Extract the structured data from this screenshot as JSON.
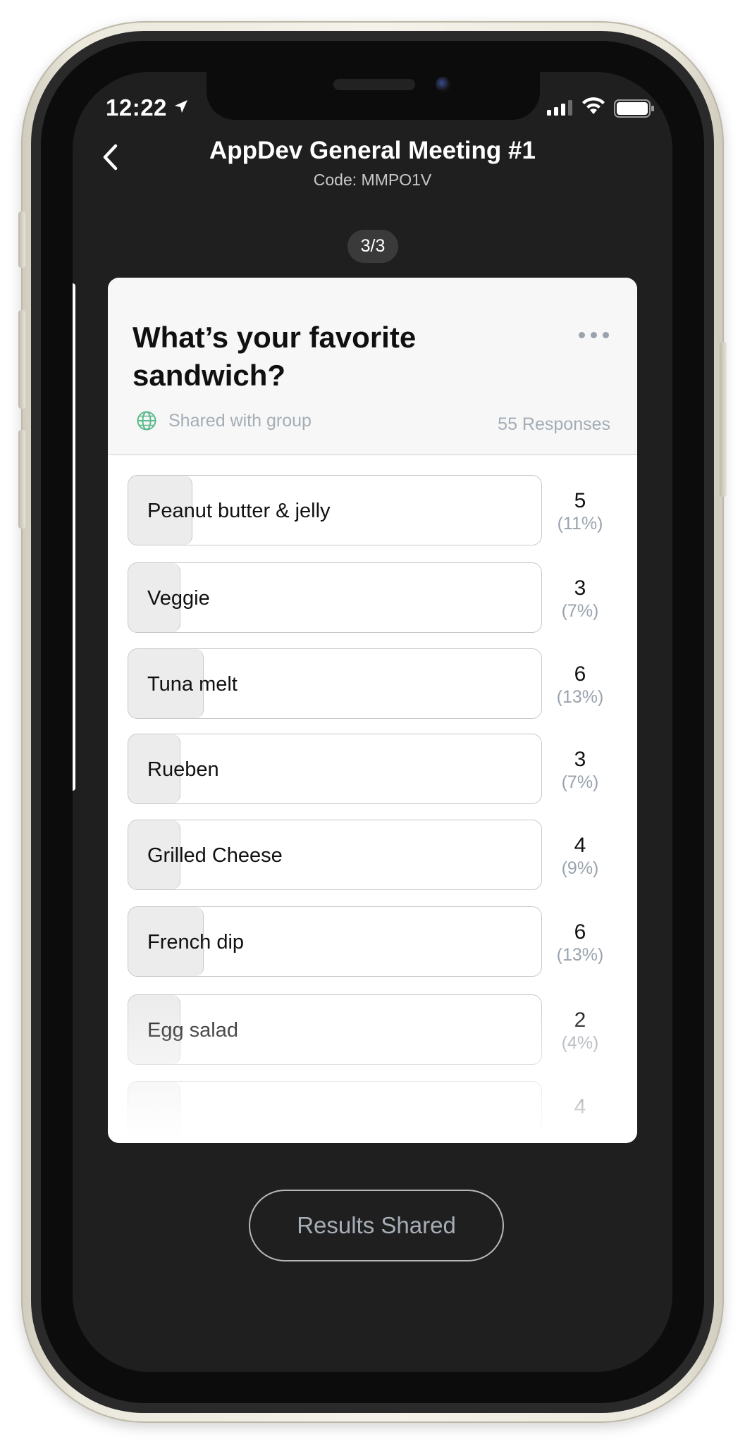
{
  "status_bar": {
    "time": "12:22"
  },
  "header": {
    "title": "AppDev General Meeting #1",
    "code": "Code: MMPO1V"
  },
  "pager": {
    "label": "3/3"
  },
  "poll": {
    "question": "What’s your favorite sandwich?",
    "visibility": "Shared with group",
    "responses": "55 Responses",
    "options": [
      {
        "label": "Peanut butter & jelly",
        "count": "5",
        "percent": "(11%)",
        "share": 0.11
      },
      {
        "label": "Veggie",
        "count": "3",
        "percent": "(7%)",
        "share": 0.07
      },
      {
        "label": "Tuna melt",
        "count": "6",
        "percent": "(13%)",
        "share": 0.13
      },
      {
        "label": "Rueben",
        "count": "3",
        "percent": "(7%)",
        "share": 0.07
      },
      {
        "label": "Grilled Cheese",
        "count": "4",
        "percent": "(9%)",
        "share": 0.09
      },
      {
        "label": "French dip",
        "count": "6",
        "percent": "(13%)",
        "share": 0.13
      },
      {
        "label": "Egg salad",
        "count": "2",
        "percent": "(4%)",
        "share": 0.04
      },
      {
        "label": "",
        "count": "4",
        "percent": "",
        "share": 0.09
      }
    ]
  },
  "footer": {
    "results_button": "Results Shared"
  },
  "colors": {
    "screen_bg": "#1f1f1f",
    "card_bg": "#ffffff",
    "fill": "#ececec",
    "muted_text": "#a4adb6",
    "globe_accent": "#5bb98c"
  },
  "icons": {
    "back": "chevron-left-icon",
    "location": "location-arrow-icon",
    "signal": "cellular-signal-icon",
    "wifi": "wifi-icon",
    "battery": "battery-icon",
    "globe": "globe-icon",
    "more": "more-horizontal-icon"
  }
}
